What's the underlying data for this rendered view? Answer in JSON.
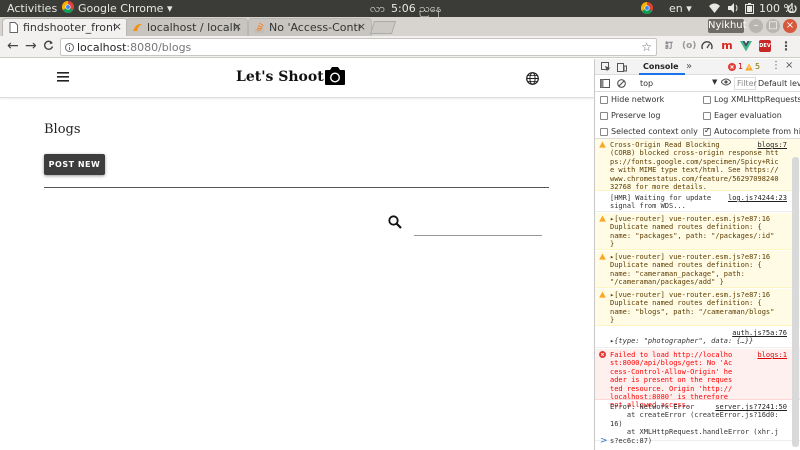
{
  "os": {
    "activities": "Activities",
    "app_name": "Google Chrome",
    "lang_my": "လာ",
    "clock": "5:06 ညနေ",
    "lang_en": "en",
    "battery": "100 %"
  },
  "tabs": [
    {
      "title": "findshooter_fronte",
      "close": "×"
    },
    {
      "title": "localhost / localho",
      "close": "×"
    },
    {
      "title": "No 'Access-Control",
      "close": "×"
    }
  ],
  "profile_label": "Nyikhut",
  "toolbar": {
    "back": "←",
    "forward": "→",
    "reload": "C",
    "url_host": "localhost",
    "url_path": ":8080/blogs",
    "ext_labels": [
      "m",
      "DEV"
    ]
  },
  "page": {
    "brand": "Let's Shoot",
    "heading": "Blogs",
    "post_new": "POST NEW"
  },
  "devtools": {
    "tab": "Console",
    "more": "»",
    "error_count": "1",
    "warn_count": "5",
    "context": "top",
    "filter_placeholder": "Filter",
    "level": "Default leve",
    "options": [
      {
        "label": "Hide network",
        "checked": false
      },
      {
        "label": "Log XMLHttpRequests",
        "checked": false
      },
      {
        "label": "Preserve log",
        "checked": false
      },
      {
        "label": "Eager evaluation",
        "checked": false
      },
      {
        "label": "Selected context only",
        "checked": false
      },
      {
        "label": "Autocomplete from histo",
        "checked": true
      }
    ],
    "messages": [
      {
        "level": "warn",
        "src": "blogs:7",
        "text": "Cross-Origin Read Blocking\n(CORB) blocked cross-origin response https://fonts.google.com/specimen/Spicy+Rice with MIME type text/html. See https://www.chromestatus.com/feature/5629709824032768 for more details."
      },
      {
        "level": "info",
        "src": "log.js?4244:23",
        "text": "[HMR] Waiting for update\nsignal from WDS..."
      },
      {
        "level": "warn",
        "src": "vue-router.esm.js?e87:16",
        "text": "▸[vue-router] vue-router.esm.js?e87:16\nDuplicate named routes definition: {\nname: \"packages\", path: \"/packages/:id\"\n}"
      },
      {
        "level": "warn",
        "src": "",
        "text": "▸[vue-router] vue-router.esm.js?e87:16\nDuplicate named routes definition: {\nname: \"cameraman_package\", path:\n\"/cameraman/packages/add\" }"
      },
      {
        "level": "warn",
        "src": "",
        "text": "▸[vue-router] vue-router.esm.js?e87:16\nDuplicate named routes definition: {\nname: \"blogs\", path: \"/cameraman/blogs\"\n}"
      },
      {
        "level": "info",
        "src": "auth.js?5a:76",
        "text": "\n▸{type: \"photographer\", data: {…}}"
      },
      {
        "level": "err",
        "src": "blogs:1",
        "text": "Failed to load http://localhost:8000/api/blogs/get: No 'Access-Control-Allow-Origin' header is present on the requested resource. Origin 'http://localhost:8080' is therefore not allowed access."
      },
      {
        "level": "info",
        "src": "server.js?7241:50",
        "text": "Error: Network Error\n    at createError (createError.js?16d0:16)\n    at XMLHttpRequest.handleError (xhr.js?ec6c:87)"
      }
    ],
    "prompt": ">"
  }
}
